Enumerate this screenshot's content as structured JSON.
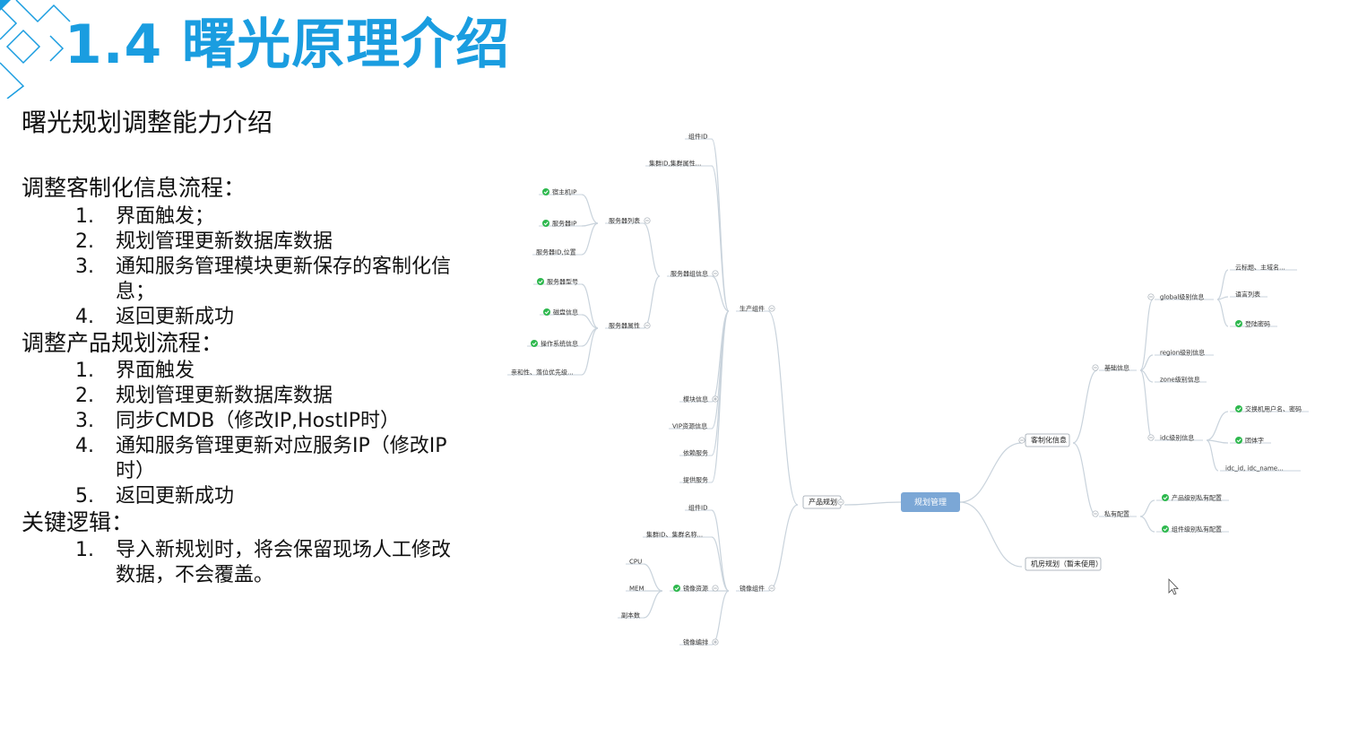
{
  "slide": {
    "title": "1.4 曙光原理介绍",
    "subtitle": "曙光规划调整能力介绍",
    "sections": [
      {
        "heading": "调整客制化信息流程：",
        "items": [
          {
            "num": "1.",
            "text": "界面触发；"
          },
          {
            "num": "2.",
            "text": "规划管理更新数据库数据"
          },
          {
            "num": "3.",
            "text": "通知服务管理模块更新保存的客制化信息；"
          },
          {
            "num": "4.",
            "text": "返回更新成功"
          }
        ]
      },
      {
        "heading": "调整产品规划流程：",
        "items": [
          {
            "num": "1.",
            "text": "界面触发"
          },
          {
            "num": "2.",
            "text": "规划管理更新数据库数据"
          },
          {
            "num": "3.",
            "text": "同步CMDB（修改IP,HostIP时）"
          },
          {
            "num": "4.",
            "text": "通知服务管理更新对应服务IP（修改IP时）"
          },
          {
            "num": "5.",
            "text": "返回更新成功"
          }
        ]
      },
      {
        "heading": "关键逻辑：",
        "items": [
          {
            "num": "1.",
            "text": "导入新规划时，将会保留现场人工修改数据，不会覆盖。"
          }
        ]
      }
    ]
  },
  "mindmap": {
    "root": "规划管理",
    "root_color": "#7ba7d6",
    "check_color": "#2db84d",
    "line_color": "#c9d3dc",
    "nodes": [
      {
        "id": "n1",
        "text": "组件ID"
      },
      {
        "id": "n2",
        "text": "集群ID,集群属性..."
      },
      {
        "id": "n3",
        "text": "宿主机IP",
        "check": true
      },
      {
        "id": "n4",
        "text": "服务器IP",
        "check": true
      },
      {
        "id": "n5",
        "text": "服务器ID,位置"
      },
      {
        "id": "n6",
        "text": "服务器列表",
        "toggle": "-"
      },
      {
        "id": "n7",
        "text": "服务器型号",
        "check": true
      },
      {
        "id": "n8",
        "text": "磁盘信息",
        "check": true
      },
      {
        "id": "n9",
        "text": "操作系统信息",
        "check": true
      },
      {
        "id": "n10",
        "text": "亲和性、落位优先级..."
      },
      {
        "id": "n11",
        "text": "服务器属性",
        "toggle": "-"
      },
      {
        "id": "n12",
        "text": "服务器组信息",
        "toggle": "-"
      },
      {
        "id": "n13",
        "text": "生产组件",
        "toggle": "-"
      },
      {
        "id": "n14",
        "text": "模块信息",
        "toggle": "+"
      },
      {
        "id": "n15",
        "text": "VIP资源信息"
      },
      {
        "id": "n16",
        "text": "依赖服务"
      },
      {
        "id": "n17",
        "text": "提供服务"
      },
      {
        "id": "n18",
        "text": "组件ID"
      },
      {
        "id": "n19",
        "text": "集群ID、集群名称..."
      },
      {
        "id": "n20",
        "text": "CPU"
      },
      {
        "id": "n21",
        "text": "MEM"
      },
      {
        "id": "n22",
        "text": "副本数"
      },
      {
        "id": "n23",
        "text": "镜像资源",
        "check": true,
        "toggle": "-"
      },
      {
        "id": "n24",
        "text": "镜像编排",
        "toggle": "+"
      },
      {
        "id": "n25",
        "text": "镜像组件",
        "toggle": "-"
      },
      {
        "id": "n26",
        "text": "产品规划",
        "toggle": "-",
        "box": true
      },
      {
        "id": "n27",
        "text": "客制化信息",
        "toggle": "-",
        "box": true
      },
      {
        "id": "n28",
        "text": "机房规划（暂未使用）",
        "box": true
      },
      {
        "id": "n29",
        "text": "基础信息",
        "toggle": "-"
      },
      {
        "id": "n30",
        "text": "私有配置",
        "toggle": "-"
      },
      {
        "id": "n31",
        "text": "global级别信息",
        "toggle": "-"
      },
      {
        "id": "n32",
        "text": "region级别信息"
      },
      {
        "id": "n33",
        "text": "zone级别信息"
      },
      {
        "id": "n34",
        "text": "idc级别信息",
        "toggle": "-"
      },
      {
        "id": "n35",
        "text": "云标题、主域名..."
      },
      {
        "id": "n36",
        "text": "语言列表"
      },
      {
        "id": "n37",
        "text": "登陆密码",
        "check": true
      },
      {
        "id": "n38",
        "text": "交换机用户名、密码",
        "check": true
      },
      {
        "id": "n39",
        "text": "团体字",
        "check": true
      },
      {
        "id": "n40",
        "text": "idc_id, idc_name..."
      },
      {
        "id": "n41",
        "text": "产品级别私有配置",
        "check": true
      },
      {
        "id": "n42",
        "text": "组件级别私有配置",
        "check": true
      }
    ]
  }
}
